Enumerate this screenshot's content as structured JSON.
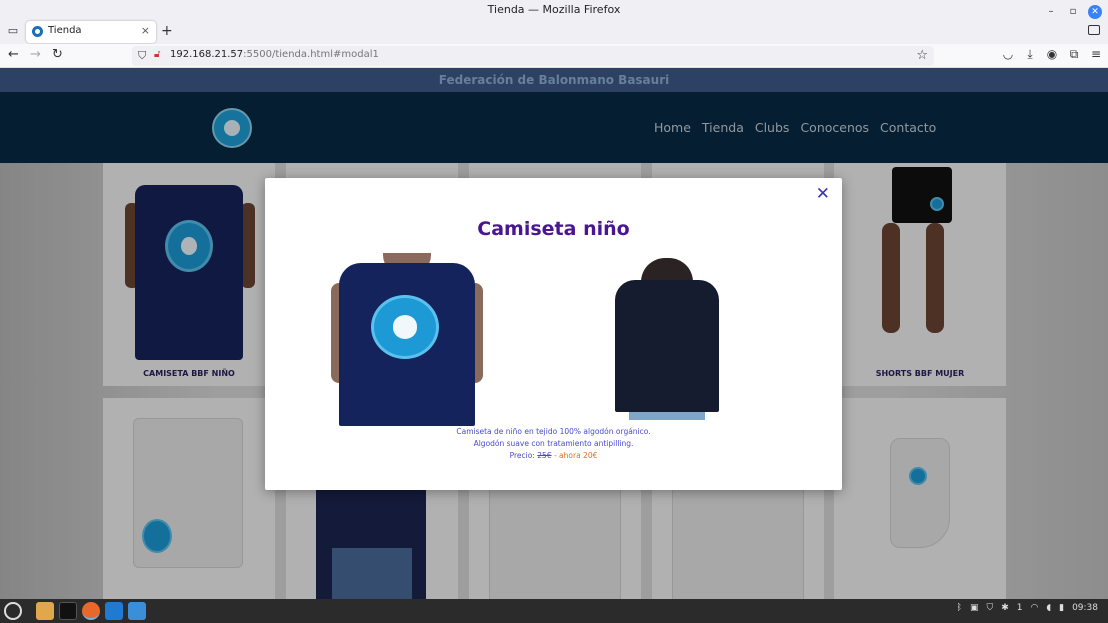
{
  "window": {
    "title": "Tienda — Mozilla Firefox",
    "minimize_icon": "minimize-icon",
    "restore_icon": "restore-icon",
    "close_icon": "close-icon"
  },
  "tab": {
    "title": "Tienda",
    "close_label": "×"
  },
  "newtab_label": "+",
  "url": {
    "host": "192.168.21.57",
    "rest": ":5500/tienda.html#modal1"
  },
  "site": {
    "banner": "Federación de Balonmano Basauri",
    "menu": [
      "Home",
      "Tienda",
      "Clubs",
      "Conocenos",
      "Contacto"
    ]
  },
  "cards": {
    "left_label": "CAMISETA BBF NIÑO",
    "right_label": "SHORTS BBF MUJER"
  },
  "modal": {
    "close_label": "✕",
    "title": "Camiseta niño",
    "desc_line1": "Camiseta de niño en tejido 100% algodón orgánico.",
    "desc_line2": "Algodón suave con tratamiento antipilling.",
    "price_prefix": "Precio:",
    "price_old": "25€",
    "price_new": "- ahora 20€"
  },
  "taskbar": {
    "network": "1",
    "time": "09:38"
  },
  "colors": {
    "accent": "#4a1592",
    "link": "#3a33b5",
    "header_bg": "#072a45",
    "banner_bg": "#3d5a8a",
    "price_new": "#e07020"
  }
}
